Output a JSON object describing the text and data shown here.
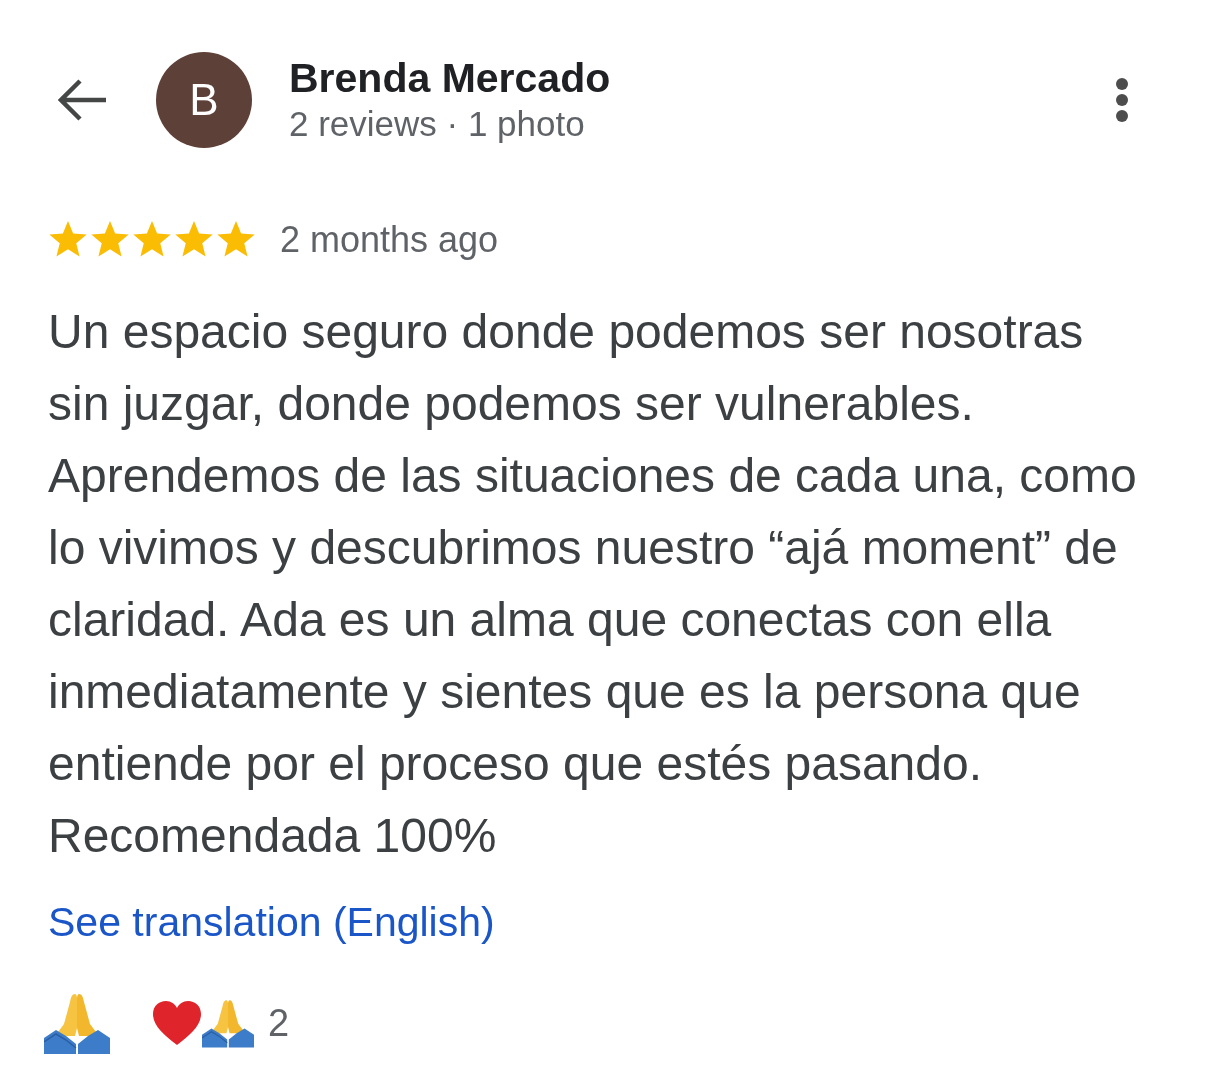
{
  "header": {
    "avatar_letter": "B",
    "name": "Brenda Mercado",
    "subtitle": "2 reviews · 1 photo"
  },
  "review": {
    "stars": 5,
    "time": "2 months ago",
    "text": "Un espacio seguro donde podemos ser nosotras sin juzgar, donde podemos ser vulnerables. Aprendemos de las situaciones de cada una, como lo vivimos y descubrimos nuestro “ajá moment” de claridad. Ada es un alma que conectas con ella inmediatamente y sientes que es la persona que entiende por el proceso que estés pasando. Recomendada 100%",
    "translation_link": "See translation (English)"
  },
  "reactions": {
    "count": "2"
  }
}
